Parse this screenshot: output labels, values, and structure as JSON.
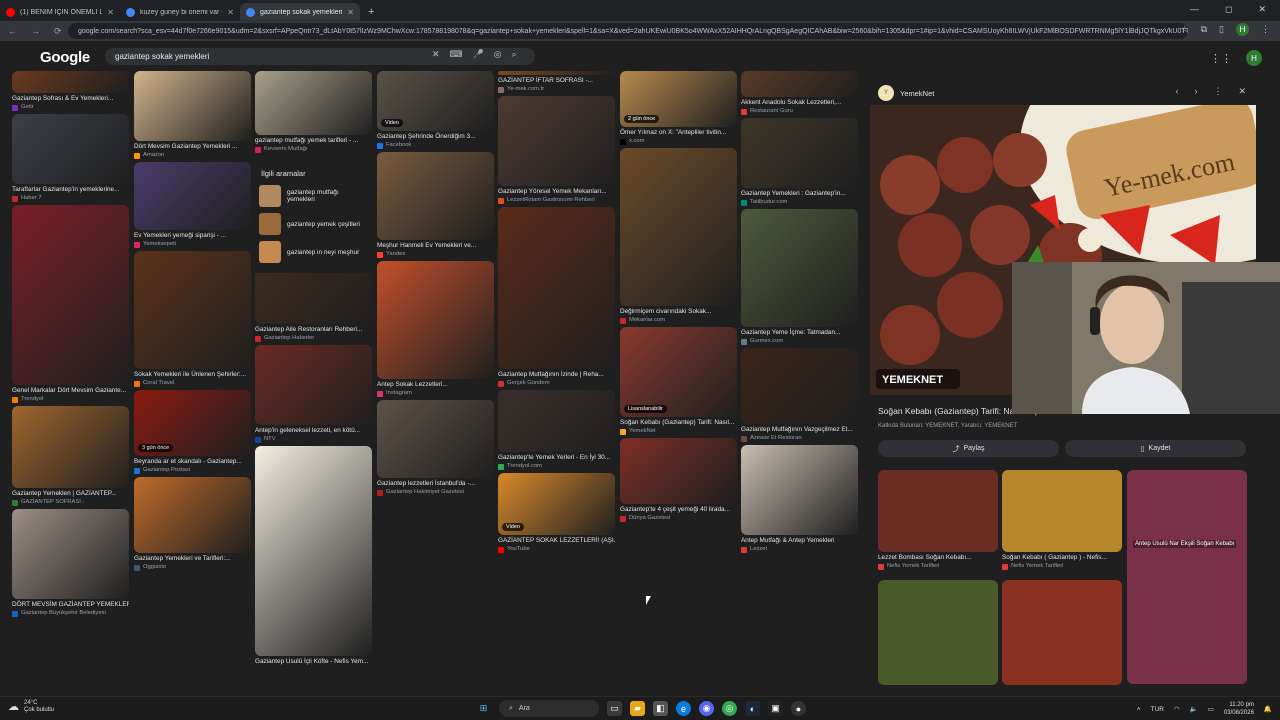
{
  "browser": {
    "tabs": [
      {
        "label": "(1) BENİM İÇİN ÖNEMLİ LANI !!!",
        "color": "#ff0000"
      },
      {
        "label": "kuzey guney bi onemi var - Go...",
        "color": "#4285f4"
      },
      {
        "label": "gaziantep sokak yemekleri - Go...",
        "color": "#4285f4"
      }
    ],
    "url": "google.com/search?sca_esv=44d7f0e7266e9015&udm=2&sxsrf=APpeQntr73_dLtAbY0t57lIzWz9MChwXcw:1785788198078&q=gaziantep+sokak+yemekleri&spell=1&sa=X&ved=2ahUKEwiU0BK5o4WWAxX52AIHHQrALngQBSgAegQICAhAB&biw=2560&bih=1305&dpr=1#ip=1&vhid=CSAMSUoyKh8ILWVjUkF2MlBOSDFWRTRNMg5lY1lBdjJQTkgxVkU0TTo...",
    "avatar_letter": "H",
    "window_controls": [
      "—",
      "◻",
      "✕"
    ]
  },
  "google": {
    "logo": "Google",
    "query": "gaziantep sokak yemekleri",
    "avatar_letter": "H"
  },
  "columns": [
    [
      {
        "title": "Gaziantep Sofrası & Ev Yemekleri...",
        "source": "Getir",
        "color": "#6b3a1e",
        "h": 22,
        "icon": "#7b2cbf"
      },
      {
        "title": "Taraftarlar Gaziantep'in yemeklerine...",
        "source": "Haber 7",
        "color": "#3b3f48",
        "h": 70,
        "icon": "#c62828"
      },
      {
        "title": "Genel Markalar Dört Mevsim Gaziante...",
        "source": "Trendyol",
        "color": "#7a1f26",
        "h": 180,
        "icon": "#f57c00"
      },
      {
        "title": "Gaziantep Yemekleri | GAZİANTEP...",
        "source": "GAZİANTEP SOFRASI -",
        "color": "#a0662e",
        "h": 82,
        "icon": "#2e7d32"
      },
      {
        "title": "DÖRT MEVSİM GAZİANTEP YEMEKLER...",
        "source": "Gaziantep Büyükşehir Belediyesi",
        "color": "#9c8f86",
        "h": 90,
        "icon": "#1565c0"
      }
    ],
    [
      {
        "title": "Dört Mevsim Gaziantep Yemekleri ...",
        "source": "Amazon",
        "color": "#d2b48c",
        "h": 70,
        "icon": "#ff9900"
      },
      {
        "title": "Ev Yemekleri yemeği siparişi - ...",
        "source": "Yemeksepeti",
        "color": "#4a3b6b",
        "h": 68,
        "icon": "#e91e63"
      },
      {
        "title": "Sokak Yemekleri ile Ünlenen Şehirler:...",
        "source": "Coral Travel",
        "color": "#5c3218",
        "h": 118,
        "icon": "#ff6f00"
      },
      {
        "title": "Beyranda ar et skandalı - Gaziantep...",
        "source": "Gaziantep Postası",
        "color": "#8b1a10",
        "h": 66,
        "icon": "#1976d2",
        "badge": "3 gün önce"
      },
      {
        "title": "Gaziantep Yemekleri ve Tarifleri:...",
        "source": "Ogguisto",
        "color": "#c06b2a",
        "h": 76,
        "icon": "#455a64"
      }
    ],
    [
      {
        "title": "gaziantep mutfağı yemek tarifleri - ...",
        "source": "Kevserin Mutfağı",
        "color": "#a8a18a",
        "h": 64,
        "icon": "#d81b60"
      },
      {
        "title": "Gaziantep Aile Restoranları Rehberi...",
        "source": "Gaziantep Haberler",
        "color": "#3d2b1f",
        "h": 58,
        "icon": "#c62828"
      },
      {
        "title": "Antep'in geleneksel lezzeti, en kötü...",
        "source": "NTV",
        "color": "#6b2a22",
        "h": 80,
        "icon": "#0d47a1"
      },
      {
        "title": "Gaziantep Usulü İçli Köfte - Nefis Yem...",
        "source": "",
        "color": "#f4efe3",
        "h": 210,
        "icon": "#4caf50"
      }
    ],
    [
      {
        "title": "Gaziantep Şehrinde Önerdiğim 3...",
        "source": "Facebook",
        "color": "#5a5248",
        "h": 60,
        "icon": "#1877f2",
        "badge": "Video"
      },
      {
        "title": "Meşhur Hanmeli Ev Yemekleri ve...",
        "source": "Yandex",
        "color": "#7a5c3e",
        "h": 88,
        "icon": "#fc3f1d"
      },
      {
        "title": "Antep Sokak Lezzetleri...",
        "source": "Instagram",
        "color": "#c2502b",
        "h": 118,
        "icon": "#e1306c"
      },
      {
        "title": "Gaziantep lezzetleri İstanbul'da -...",
        "source": "Gaziantep Hakimiyet Gazetesi",
        "color": "#5e5348",
        "h": 78,
        "icon": "#b71c1c"
      }
    ],
    [
      {
        "title": "GAZİANTEP İFTAR SOFRASI -...",
        "source": "Ye-mek.com.tr",
        "color": "#7d4a23",
        "h": 4,
        "icon": "#8d6e63"
      },
      {
        "title": "Gaziantep Yöresel Yemek Mekanları...",
        "source": "LezzetRotam Gastronomi Rehberi",
        "color": "#4d3a32",
        "h": 90,
        "icon": "#e64a19"
      },
      {
        "title": "Gaziantep Mutfağının İzinde | Reha...",
        "source": "Gerçek Gündem",
        "color": "#5a2a18",
        "h": 162,
        "icon": "#d32f2f"
      },
      {
        "title": "Gaziantep'te Yemek Yerleri - En İyi 30...",
        "source": "Trendyol.com",
        "color": "#3a2f2a",
        "h": 62,
        "icon": "#34a853"
      },
      {
        "title": "GAZİANTEP SOKAK LEZZETLERİ! (AŞI...",
        "source": "YouTube",
        "color": "#d98a2b",
        "h": 62,
        "icon": "#ff0000",
        "badge": "Video"
      }
    ],
    [
      {
        "title": "Ömer Yılmaz on X: \"Antepliler tivitin...",
        "source": "x.com",
        "color": "#b98a4f",
        "h": 56,
        "icon": "#000000",
        "badge": "2 gün önce"
      },
      {
        "title": "Değirmiçem civarındaki Sokak...",
        "source": "Mekanlar.com",
        "color": "#6b4a28",
        "h": 158,
        "icon": "#c62828"
      },
      {
        "title": "Soğan Kebabı (Gaziantep) Tarifi: Nasıl...",
        "source": "YemekNet",
        "color": "#8a3a2e",
        "h": 90,
        "icon": "#f9a825",
        "badge": "Lisanslanabilir"
      },
      {
        "title": "Gaziantep'te 4 çeşit yemeği 40 lirada...",
        "source": "Dünya Gazetesi",
        "color": "#7d2e24",
        "h": 66,
        "icon": "#c62828"
      }
    ],
    [
      {
        "title": "Akkent Anadolu Sokak Lezzetleri,...",
        "source": "Restaurant Guru",
        "color": "#5a3a25",
        "h": 26,
        "icon": "#e53935"
      },
      {
        "title": "Gaziantep Yemekleri : Gaziantep'in...",
        "source": "Tatilbudur.com",
        "color": "#3d3528",
        "h": 70,
        "icon": "#00897b"
      },
      {
        "title": "Gaziantep Yeme İçme: Tatmadan...",
        "source": "Gurmex.com",
        "color": "#4e5a3a",
        "h": 118,
        "icon": "#607d8b"
      },
      {
        "title": "Gaziantep Mutfağının Vazgeçilmez Et...",
        "source": "Azease Et Restoran",
        "color": "#3a2418",
        "h": 76,
        "icon": "#6d4c41"
      },
      {
        "title": "Antep Mutfağı & Antep Yemekleri",
        "source": "Lezzet",
        "color": "#c9bfb2",
        "h": 90,
        "icon": "#e53935"
      }
    ]
  ],
  "related": {
    "heading": "İlgili aramalar",
    "items": [
      {
        "label": "gaziantep mutfağı yemekleri",
        "color": "#b08a5e"
      },
      {
        "label": "gaziantep yemek çeşitleri",
        "color": "#9a6a3a"
      },
      {
        "label": "gaziantep in neyi meşhur",
        "color": "#c48a50"
      }
    ]
  },
  "side_panel": {
    "site": "YemekNet",
    "title": "Soğan Kebabı (Gaziantep) Tarifi: Nasıl Yapılır?",
    "credit": "Katkıda Bulunan: YEMEKNET, Yaratıcı: YEMEKNET",
    "share_label": "Paylaş",
    "save_label": "Kaydet",
    "watermark": "Ye-mek.com",
    "brand_badge": "YEMEKNET",
    "related": [
      {
        "title": "Lezzet Bombası Soğan Kebabı...",
        "source": "Nefis Yemek Tarifleri",
        "color": "#6b2c24"
      },
      {
        "title": "Soğan Kebabı ( Gaziantep ) - Nefis...",
        "source": "Nefis Yemek Tarifleri",
        "color": "#b8862a"
      },
      {
        "title": "Antep Usulü Nar Ekşili Soğan Kebabı",
        "source": "",
        "color": "#7a3048"
      },
      {
        "title": "",
        "source": "",
        "color": "#4a5a2a"
      },
      {
        "title": "",
        "source": "",
        "color": "#8a3020"
      }
    ]
  },
  "taskbar": {
    "temp": "24°C",
    "weather": "Çok bulutlu",
    "search_placeholder": "Ara",
    "lang": "TUR",
    "time": "11:20 pm",
    "date": "03/08/2026"
  }
}
